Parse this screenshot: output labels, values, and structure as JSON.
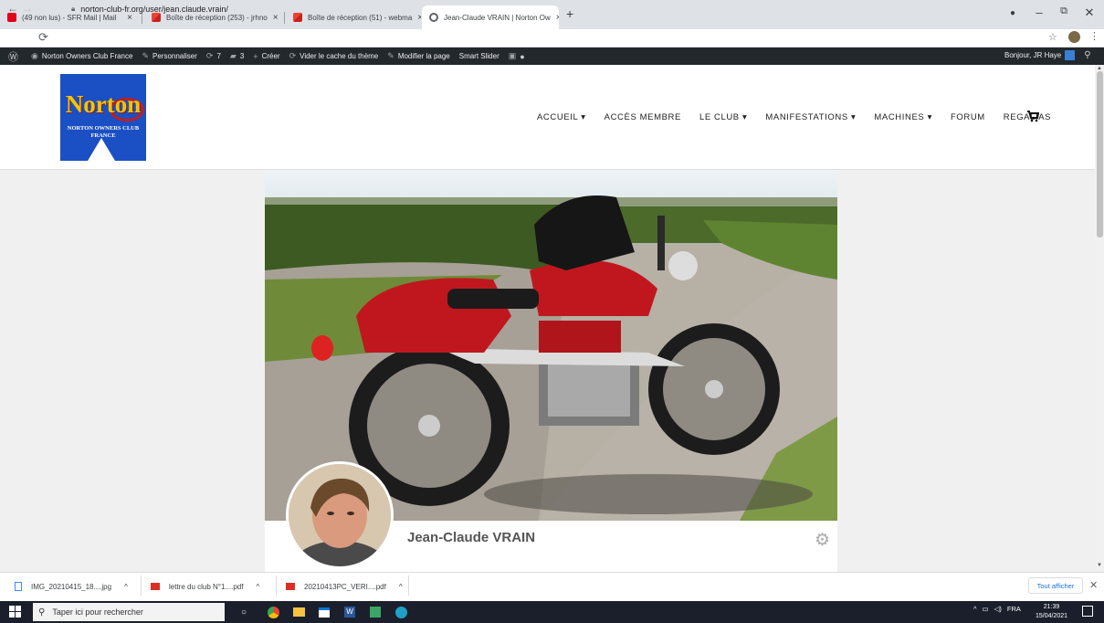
{
  "browser": {
    "tabs": [
      {
        "label": "(49 non lus) - SFR Mail | Mail"
      },
      {
        "label": "Boîte de réception (253) - jrhno"
      },
      {
        "label": "Boîte de réception (51) - webma"
      },
      {
        "label": "Jean-Claude VRAIN | Norton Ow"
      }
    ],
    "close_glyph": "×",
    "new_tab": "+",
    "url": "norton-club-fr.org/user/jean.claude.vrain/"
  },
  "wp_admin": {
    "site": "Norton Owners Club France",
    "customize": "Personnaliser",
    "updates": "7",
    "comments": "3",
    "new": "Créer",
    "cache": "Vider le cache du thème",
    "edit": "Modifier la page",
    "slider": "Smart Slider",
    "greeting": "Bonjour, JR Haye"
  },
  "site": {
    "logo_text": "Norton",
    "logo_subtitle": "NORTON OWNERS CLUB FRANCE",
    "menu": [
      {
        "label": "ACCUEIL",
        "caret": true
      },
      {
        "label": "ACCÈS MEMBRE",
        "caret": false
      },
      {
        "label": "LE CLUB",
        "caret": true
      },
      {
        "label": "MANIFESTATIONS",
        "caret": true
      },
      {
        "label": "MACHINES",
        "caret": true
      },
      {
        "label": "FORUM",
        "caret": false
      },
      {
        "label": "REGALIAS",
        "caret": false
      }
    ]
  },
  "profile": {
    "name": "Jean-Claude VRAIN"
  },
  "downloads": {
    "items": [
      {
        "label": "IMG_20210415_18....jpg"
      },
      {
        "label": "lettre du club N°1....pdf"
      },
      {
        "label": "20210413PC_VERI....pdf"
      }
    ],
    "show_all": "Tout afficher"
  },
  "taskbar": {
    "search_placeholder": "Taper ici pour rechercher",
    "lang": "FRA",
    "time": "21:39",
    "date": "15/04/2021"
  },
  "colors": {
    "wp_bar": "#23282d",
    "logo_blue": "#1b4fc4",
    "logo_gold": "#f5c400",
    "moto_red": "#c0171f"
  }
}
